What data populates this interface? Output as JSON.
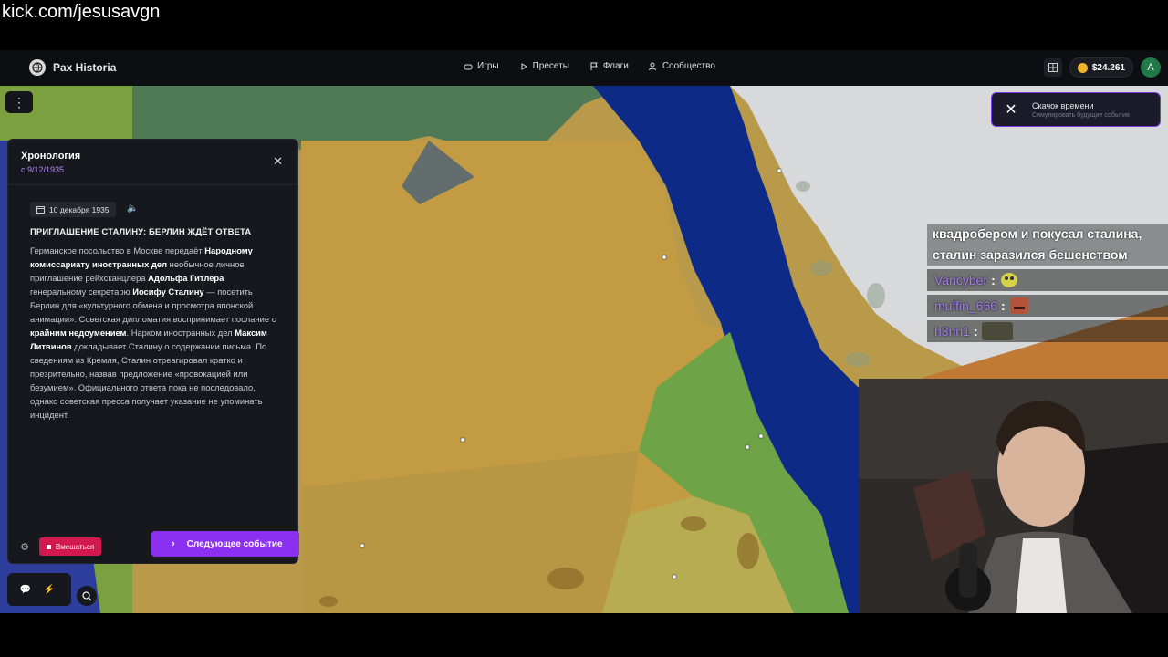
{
  "stream": {
    "url": "kick.com/jesusavgn"
  },
  "app": {
    "name": "Pax Historia",
    "nav": [
      {
        "label": "Игры",
        "icon": "gamepad-icon"
      },
      {
        "label": "Пресеты",
        "icon": "play-icon"
      },
      {
        "label": "Флаги",
        "icon": "flag-icon"
      },
      {
        "label": "Сообщество",
        "icon": "users-icon"
      }
    ],
    "balance": "$24.261",
    "avatar_letter": "A"
  },
  "time_jump": {
    "title": "Скачок времени",
    "subtitle": "Симулировать будущие события"
  },
  "timeline": {
    "title": "Хронология",
    "since": "с 9/12/1935",
    "date": "10 декабря 1935",
    "event_title": "ПРИГЛАШЕНИЕ СТАЛИНУ: БЕРЛИН ЖДЁТ ОТВЕТА",
    "body_parts": [
      "Германское посольство в Москве передаёт ",
      "Народному комиссариату иностранных дел",
      " необычное личное приглашение рейхсканцлера ",
      "Адольфа Гитлера",
      " генеральному секретарю ",
      "Иосифу Сталину",
      " — посетить Берлин для «культурного обмена и просмотра японской анимации». Советская дипломатия воспринимает послание с ",
      "крайним недоумением",
      ". Нарком иностранных дел ",
      "Максим Литвинов",
      " докладывает Сталину о содержании письма. По сведениям из Кремля, Сталин отреагировал кратко и презрительно, назвав предложение «провокацией или безумием». Официального ответа пока не последовало, однако советская пресса получает указание не упоминать инцидент."
    ],
    "intervene_label": "Вмешаться",
    "next_label": "Следующее событие"
  },
  "chat": {
    "partial_message": "квадробером и покусал сталина, сталин заразился бешенством",
    "rows": [
      {
        "user": "Vancyber",
        "emote": "pepe-emote"
      },
      {
        "user": "muffin_666",
        "emote": "face-emote"
      },
      {
        "user": "h3nn1",
        "emote": "clip-emote"
      }
    ]
  },
  "colors": {
    "accent": "#8b2ff1",
    "danger": "#d1194f",
    "link": "#b18cf5",
    "chat_user": "#a37bf0"
  }
}
